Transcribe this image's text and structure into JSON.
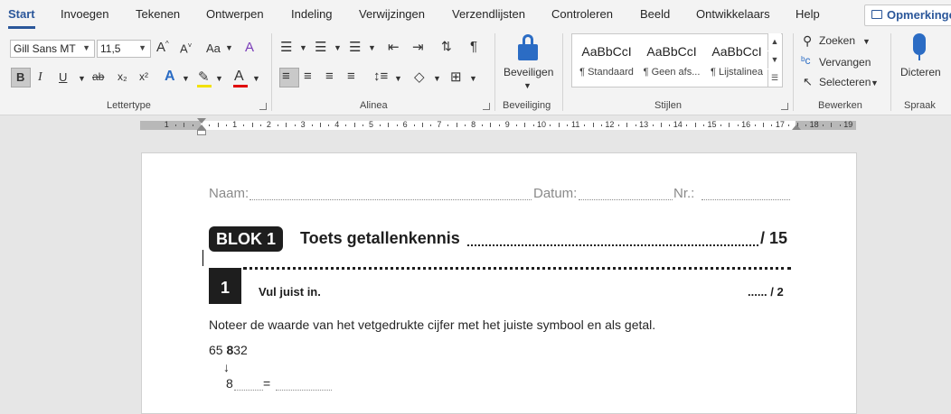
{
  "tabs": [
    "Start",
    "Invoegen",
    "Tekenen",
    "Ontwerpen",
    "Indeling",
    "Verwijzingen",
    "Verzendlijsten",
    "Controleren",
    "Beeld",
    "Ontwikkelaars",
    "Help"
  ],
  "comments_label": "Opmerkingen",
  "font": {
    "name": "Gill Sans MT",
    "size": "11,5"
  },
  "groups": {
    "lettertype": "Lettertype",
    "alinea": "Alinea",
    "beveiliging": "Beveiliging",
    "stijlen": "Stijlen",
    "bewerken": "Bewerken",
    "spraak": "Spraak"
  },
  "format_buttons": {
    "grow": "A^",
    "shrink": "A˅",
    "case": "Aa",
    "bold": "B",
    "italic": "I",
    "underline": "U",
    "strike": "ab",
    "sub": "x₂",
    "sup": "x²",
    "pilcrow": "¶"
  },
  "beveiligen_label": "Beveiligen",
  "styles": [
    {
      "preview": "AaBbCcI",
      "name": "¶ Standaard"
    },
    {
      "preview": "AaBbCcI",
      "name": "¶ Geen afs..."
    },
    {
      "preview": "AaBbCcI",
      "name": "¶ Lijstalinea"
    }
  ],
  "edit": {
    "find": "Zoeken",
    "replace": "Vervangen",
    "select": "Selecteren"
  },
  "dictate_label": "Dicteren",
  "ruler_numbers": [
    "1",
    "1",
    "2",
    "3",
    "4",
    "5",
    "6",
    "7",
    "8",
    "9",
    "10",
    "11",
    "12",
    "13",
    "14",
    "15",
    "16",
    "17",
    "18",
    "19"
  ],
  "doc": {
    "naam": "Naam:",
    "datum": "Datum:",
    "nr": "Nr.:",
    "blok": "BLOK 1",
    "title": "Toets getallenkennis",
    "score": "/ 15",
    "exercise_number": "1",
    "instruction": "Vul juist in.",
    "sub_score": "...... / 2",
    "sentence": "Noteer de waarde van het vetgedrukte cijfer met het juiste symbool en als getal.",
    "number_prefix": "65 ",
    "number_bold": "8",
    "number_suffix": "32",
    "arrow": "↓",
    "answer_digit": "8",
    "equals": "="
  }
}
